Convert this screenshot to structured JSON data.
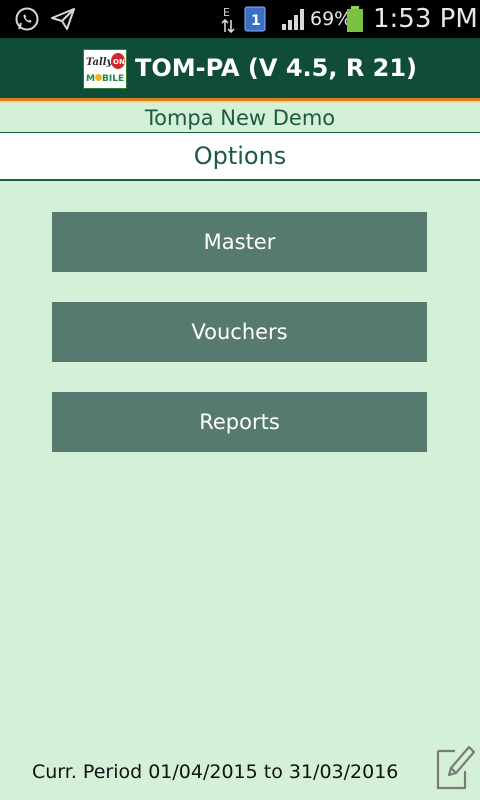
{
  "status_bar": {
    "icons": [
      "whatsapp-icon",
      "send-icon",
      "data-activity-icon",
      "sim-icon",
      "signal-icon",
      "battery-icon"
    ],
    "data_indicator": "E",
    "sim_number": "1",
    "battery_percent": "69%",
    "time": "1:53 PM"
  },
  "header": {
    "title": "TOM-PA (V 4.5, R 21)",
    "logo_icon": "tally-on-mobile-logo"
  },
  "company": {
    "name": "Tompa New Demo"
  },
  "options": {
    "title": "Options"
  },
  "menu": {
    "items": [
      {
        "label": "Master"
      },
      {
        "label": "Vouchers"
      },
      {
        "label": "Reports"
      }
    ]
  },
  "footer": {
    "period": "Curr. Period 01/04/2015 to 31/03/2016",
    "edit_icon": "edit-icon"
  },
  "colors": {
    "background": "#d4f0d7",
    "header": "#0f4c3a",
    "button": "#567a70",
    "accent": "#d87e1a",
    "text_dark": "#1c5a44"
  }
}
